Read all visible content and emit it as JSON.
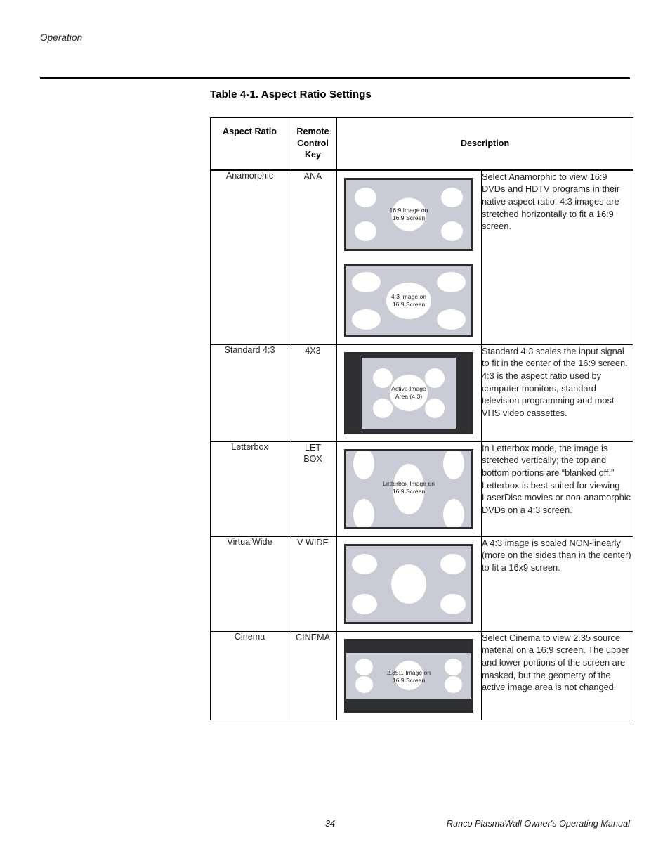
{
  "page": {
    "running_head": "Operation",
    "page_number": "34",
    "footer_title": "Runco PlasmaWall Owner's Operating Manual"
  },
  "table": {
    "caption": "Table 4-1. Aspect Ratio Settings",
    "columns": {
      "aspect_ratio": "Aspect Ratio",
      "remote_key": "Remote\nControl\nKey",
      "remote_key_line1": "Remote",
      "remote_key_line2": "Control",
      "remote_key_line3": "Key",
      "description": "Description"
    },
    "rows": [
      {
        "aspect_ratio": "Anamorphic",
        "remote_key": "ANA",
        "description": "Select Anamorphic to view 16:9 DVDs and HDTV programs in their native aspect ratio. 4:3 images are stretched horizontally to fit a 16:9 screen.",
        "figures": [
          {
            "caption": "16:9 Image on\n16:9 Screen",
            "style": "16:9 on 16:9"
          },
          {
            "caption": "4:3 Image on\n16:9 Screen",
            "style": "4:3 on 16:9"
          }
        ]
      },
      {
        "aspect_ratio": "Standard 4:3",
        "remote_key": "4X3",
        "description": "Standard 4:3 scales the input signal to fit in the center of the 16:9 screen. 4:3 is the aspect ratio used by computer monitors, standard television programming and most VHS video cassettes.",
        "figures": [
          {
            "caption": "Active Image\nArea (4:3)",
            "style": "pillarboxed 4:3"
          }
        ]
      },
      {
        "aspect_ratio": "Letterbox",
        "remote_key": "LET\nBOX",
        "remote_key_line1": "LET",
        "remote_key_line2": "BOX",
        "description": "In Letterbox mode, the image is stretched vertically; the top and bottom portions are “blanked off.” Letterbox is best suited for viewing LaserDisc movies or non-anamorphic DVDs on a 4:3 screen.",
        "figures": [
          {
            "caption": "Letterbox Image on\n16:9 Screen",
            "style": "letterbox stretched"
          }
        ]
      },
      {
        "aspect_ratio": "VirtualWide",
        "remote_key": "V-WIDE",
        "description": "A 4:3 image is scaled NON-linearly (more on the sides than in the center) to fit a 16x9 screen.",
        "figures": [
          {
            "caption": "",
            "style": "non-linear scaled"
          }
        ]
      },
      {
        "aspect_ratio": "Cinema",
        "remote_key": "CINEMA",
        "description": "Select Cinema to view 2.35 source material on a 16:9 screen. The upper and lower portions of the screen are masked, but the geometry of the active image area is not changed.",
        "figures": [
          {
            "caption": "2.35:1 Image on\n16:9 Screen",
            "style": "2.35:1 masked"
          }
        ]
      }
    ]
  },
  "colors": {
    "screen_gray": "#c9ccd4",
    "screen_border": "#2b2b2b",
    "mask_dark": "#2f3033",
    "blob_white": "#ffffff",
    "text": "#262626"
  }
}
